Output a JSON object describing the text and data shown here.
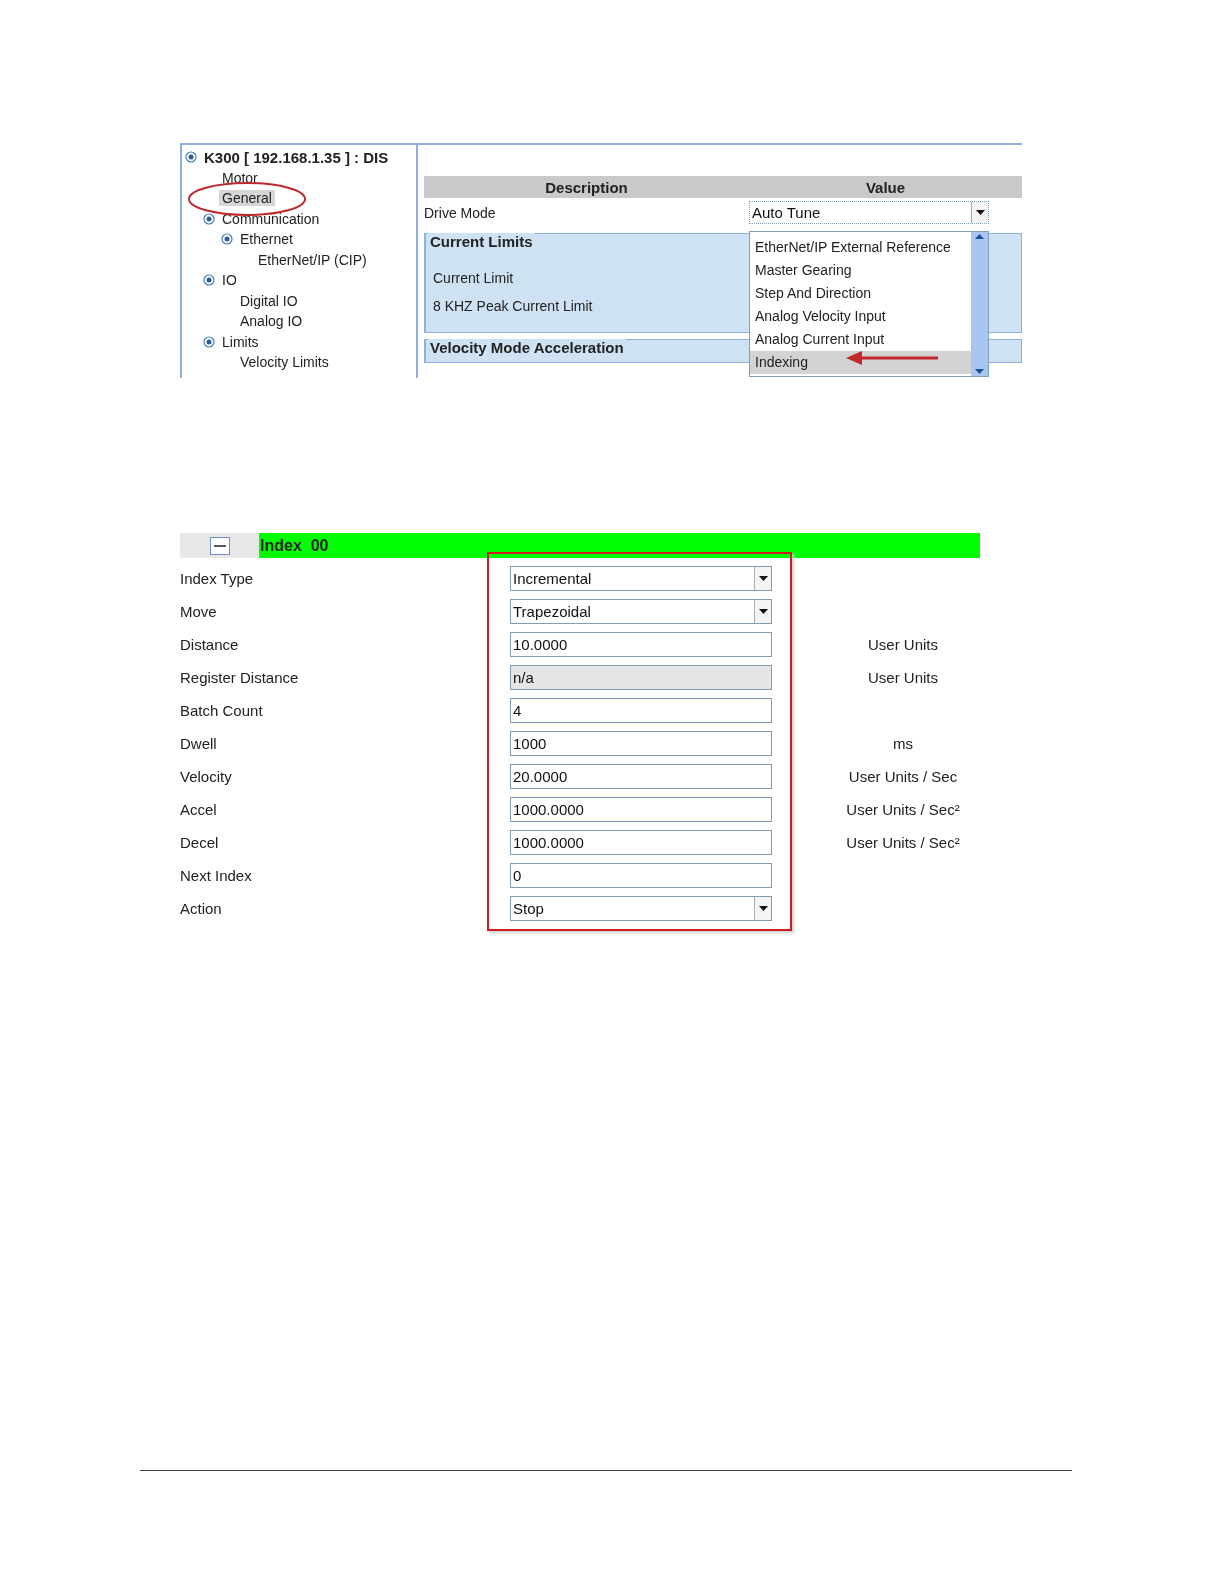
{
  "tree": {
    "label": "K300 [ 192.168.1.35 ]  : DIS",
    "selected": false,
    "expanded": true,
    "children": [
      {
        "label": "Motor",
        "selected": false
      },
      {
        "label": "General",
        "selected": true
      },
      {
        "label": "Communication",
        "selected": false,
        "expanded": true,
        "children": [
          {
            "label": "Ethernet",
            "selected": false,
            "expanded": true,
            "children": [
              {
                "label": "EtherNet/IP (CIP)",
                "selected": false
              }
            ]
          }
        ]
      },
      {
        "label": "IO",
        "selected": false,
        "expanded": true,
        "children": [
          {
            "label": "Digital IO",
            "selected": false
          },
          {
            "label": "Analog IO",
            "selected": false
          }
        ]
      },
      {
        "label": "Limits",
        "selected": false,
        "expanded": true,
        "children": [
          {
            "label": "Velocity Limits",
            "selected": false
          }
        ]
      }
    ]
  },
  "properties": {
    "columns": [
      "Description",
      "Value"
    ],
    "drive_mode": {
      "label": "Drive Mode",
      "value": "Auto Tune",
      "expanded": true,
      "options": [
        {
          "label": "EtherNet/IP External Reference",
          "selected": false
        },
        {
          "label": "Master Gearing",
          "selected": false
        },
        {
          "label": "Step And Direction",
          "selected": false
        },
        {
          "label": "Analog Velocity Input",
          "selected": false
        },
        {
          "label": "Analog Current Input",
          "selected": false
        },
        {
          "label": "Indexing",
          "selected": true
        }
      ]
    },
    "groups": [
      {
        "title": "Current Limits",
        "rows": [
          "Current Limit",
          "8 KHZ Peak Current Limit"
        ]
      },
      {
        "title": "Velocity Mode Acceleration"
      }
    ]
  },
  "index": {
    "title": "Index  00",
    "expanded": true,
    "fields": [
      {
        "label": "Index Type",
        "kind": "dropdown",
        "value": "Incremental",
        "disabled": false
      },
      {
        "label": "Move",
        "kind": "dropdown",
        "value": "Trapezoidal",
        "disabled": false
      },
      {
        "label": "Distance",
        "kind": "text",
        "value": "10.0000",
        "disabled": false,
        "unit": "User Units"
      },
      {
        "label": "Register Distance",
        "kind": "text",
        "value": "n/a",
        "disabled": true,
        "unit": "User Units"
      },
      {
        "label": "Batch Count",
        "kind": "text",
        "value": "4",
        "disabled": false
      },
      {
        "label": "Dwell",
        "kind": "text",
        "value": "1000",
        "disabled": false,
        "unit": "ms"
      },
      {
        "label": "Velocity",
        "kind": "text",
        "value": "20.0000",
        "disabled": false,
        "unit": "User Units / Sec"
      },
      {
        "label": "Accel",
        "kind": "text",
        "value": "1000.0000",
        "disabled": false,
        "unit": "User Units / Sec²"
      },
      {
        "label": "Decel",
        "kind": "text",
        "value": "1000.0000",
        "disabled": false,
        "unit": "User Units / Sec²"
      },
      {
        "label": "Next Index",
        "kind": "text",
        "value": "0",
        "disabled": false
      },
      {
        "label": "Action",
        "kind": "dropdown",
        "value": "Stop",
        "disabled": false
      }
    ]
  }
}
